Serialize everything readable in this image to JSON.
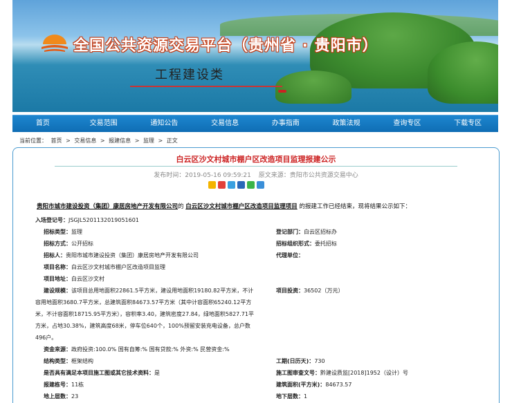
{
  "banner": {
    "title": "全国公共资源交易平台（贵州省 · 贵阳市）",
    "subtitle": "工程建设类"
  },
  "nav": {
    "items": [
      "首页",
      "交易范围",
      "通知公告",
      "交易信息",
      "办事指南",
      "政策法规",
      "查询专区",
      "下载专区"
    ]
  },
  "breadcrumb": {
    "label": "当前位置：",
    "items": [
      "首页",
      "交易信息",
      "报建信息",
      "监理",
      "正文"
    ],
    "sep": ">"
  },
  "article": {
    "title": "白云区沙文村城市棚户区改造项目监理报建公示",
    "publish_time": "发布时间：2019-05-16 09:59:21",
    "source": "原文来源：贵阳市公共资源交易中心",
    "share_icons": [
      "qzone-icon",
      "weibo-icon",
      "tencent-weibo-icon",
      "renren-icon",
      "wechat-icon",
      "more-icon"
    ],
    "intro_org": "贵阳市城市建设投资（集团）康居房地产开发有限公司",
    "intro_de": "的",
    "intro_project": "白云区沙文村城市棚户区改造项目监理项目",
    "intro_tail": "的报建工作已经结束，现将结果公示如下："
  },
  "fields": {
    "entry_no_label": "入场登记号：",
    "entry_no": "JSGJL5201132019051601",
    "bid_type_label": "招标类型：",
    "bid_type": "监理",
    "reg_dept_label": "登记部门：",
    "reg_dept": "白云区招标办",
    "bid_method_label": "招标方式：",
    "bid_method": "公开招标",
    "org_form_label": "招标组织形式：",
    "org_form": "委托招标",
    "tenderer_label": "招标人：",
    "tenderer": "贵阳市城市建设投资（集团）康居房地产开发有限公司",
    "agent_label": "代理单位：",
    "agent": "",
    "project_name_label": "项目名称：",
    "project_name": "白云区沙文村城市棚户区改造项目监理",
    "project_addr_label": "项目地址：",
    "project_addr": "白云区沙文村",
    "scale_label": "建设规模：",
    "scale": "该项目总用地面积22861.5平方米，建设用地面积19180.82平方米，不计容用地面积3680.7平方米，总建筑面积84673.57平方米（其中计容面积65240.12平方米，不计容面积18715.95平方米），容积率3.40，建筑密度27.84，绿地面积5827.71平方米，占地30.38%，建筑高度68米，停车位640个，100%预留安装充电设备，总户数496户。",
    "investment_label": "项目投资：",
    "investment": "36502（万元）",
    "funding_label": "资金来源：",
    "funding": "政府投资:100.0% 国有自筹:% 国有贷款:% 外资:% 民营资金:%",
    "structure_label": "结构类型：",
    "structure": "框架结构",
    "duration_label": "工期(日历天)：",
    "duration": "730",
    "meets_label": "是否具有满足本项目施工图或其它技术资料：",
    "meets": "是",
    "review_label": "施工图审查文号：",
    "review": "黔建设质监[2018]1952（设计）号",
    "buildings_label": "报建栋号：",
    "buildings": "11栋",
    "area_label": "建筑面积(平方米)：",
    "area": "84673.57",
    "floors_up_label": "地上层数：",
    "floors_up": "23",
    "floors_down_label": "地下层数：",
    "floors_down": "1"
  }
}
